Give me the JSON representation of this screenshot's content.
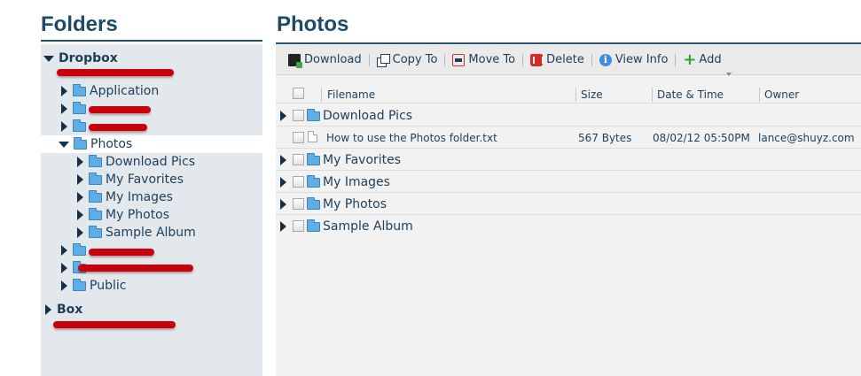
{
  "left_title": "Folders",
  "right_title": "Photos",
  "tree": {
    "dropbox": "Dropbox",
    "application": "Application",
    "photos": "Photos",
    "download_pics": "Download Pics",
    "my_favorites": "My Favorites",
    "my_images": "My Images",
    "my_photos": "My Photos",
    "sample_album": "Sample Album",
    "public": "Public",
    "box": "Box"
  },
  "toolbar": {
    "download": "Download",
    "copy_to": "Copy To",
    "move_to": "Move To",
    "delete": "Delete",
    "view_info": "View Info",
    "add": "Add"
  },
  "columns": {
    "filename": "Filename",
    "size": "Size",
    "date_time": "Date & Time",
    "owner": "Owner"
  },
  "rows": [
    {
      "name": "Download Pics"
    },
    {
      "name": "How to use the Photos folder.txt",
      "size": "567 Bytes",
      "date": "08/02/12 05:50PM",
      "owner": "lance@shuyz.com"
    },
    {
      "name": "My Favorites"
    },
    {
      "name": "My Images"
    },
    {
      "name": "My Photos"
    },
    {
      "name": "Sample Album"
    }
  ]
}
